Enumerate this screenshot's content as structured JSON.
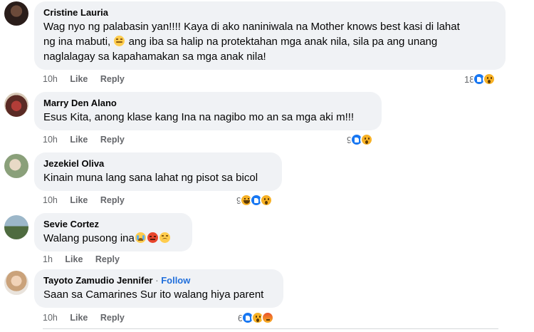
{
  "comments": [
    {
      "author": "Cristine Lauria",
      "text_lines": [
        "Wag nyo ng palabasin yan!!!! Kaya di ako naniniwala na Mother knows best kasi di lahat",
        "ng ina mabuti,",
        " ang iba sa halip na protektahan mga anak nila, sila pa ang unang",
        "naglalagay sa kapahamakan sa mga anak nila!"
      ],
      "time": "10h",
      "like": "Like",
      "reply": "Reply",
      "reaction_count": "18",
      "reactions": [
        "like-icon",
        "wow-icon"
      ]
    },
    {
      "author": "Marry Den Alano",
      "text": "Esus Kita, anong klase kang Ina na nagibo mo an sa mga aki m!!!",
      "time": "10h",
      "like": "Like",
      "reply": "Reply",
      "reaction_count": "9",
      "reactions": [
        "like-icon",
        "wow-icon"
      ]
    },
    {
      "author": "Jezekiel Oliva",
      "text": "Kinain muna lang sana lahat ng pisot sa bicol",
      "time": "10h",
      "like": "Like",
      "reply": "Reply",
      "reaction_count": "9",
      "reactions": [
        "haha-icon",
        "like-icon",
        "wow-icon"
      ]
    },
    {
      "author": "Sevie Cortez",
      "text": "Walang pusong ina",
      "time": "1h",
      "like": "Like",
      "reply": "Reply",
      "reactions": []
    },
    {
      "author": "Tayoto Zamudio Jennifer",
      "separator": "·",
      "follow": "Follow",
      "text": "Saan sa Camarines Sur ito walang hiya parent",
      "time": "10h",
      "like": "Like",
      "reply": "Reply",
      "reaction_count": "6",
      "reactions": [
        "like-icon",
        "wow-icon",
        "angry-icon"
      ]
    }
  ],
  "colors": {
    "bubble": "#f0f2f5",
    "link": "#216fdb",
    "meta": "#65676b",
    "like": "#1877f2"
  }
}
